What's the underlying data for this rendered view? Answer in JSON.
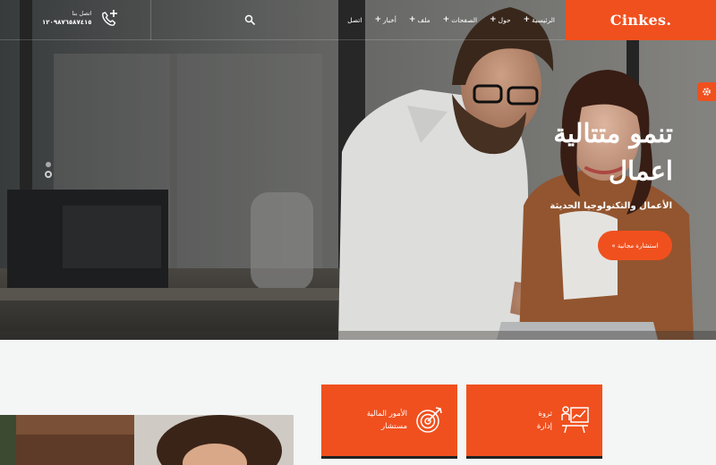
{
  "brand": {
    "logo_text": "Cinkes.",
    "accent": "#f0501e"
  },
  "nav": {
    "items": [
      {
        "label": "الرئيسية"
      },
      {
        "label": "حول"
      },
      {
        "label": "الصفحات"
      },
      {
        "label": "ملف"
      },
      {
        "label": "أخبار"
      },
      {
        "label": "اتصل"
      }
    ]
  },
  "contact": {
    "label": "اتصل بنا",
    "phone": "١٢٠٩٨٧٦٥٨٧٤١٥"
  },
  "hero": {
    "title": "تنمو متتالية اعمال",
    "subtitle": "الأعمال والتكنولوجيا الحديثة",
    "cta_label": "استشارة مجانية »"
  },
  "cards": [
    {
      "line1": "ثروة",
      "line2": "إدارة",
      "icon": "presentation-chart-icon"
    },
    {
      "line1": "الأمور المالية",
      "line2": "مستشار",
      "icon": "target-arrow-icon"
    }
  ]
}
